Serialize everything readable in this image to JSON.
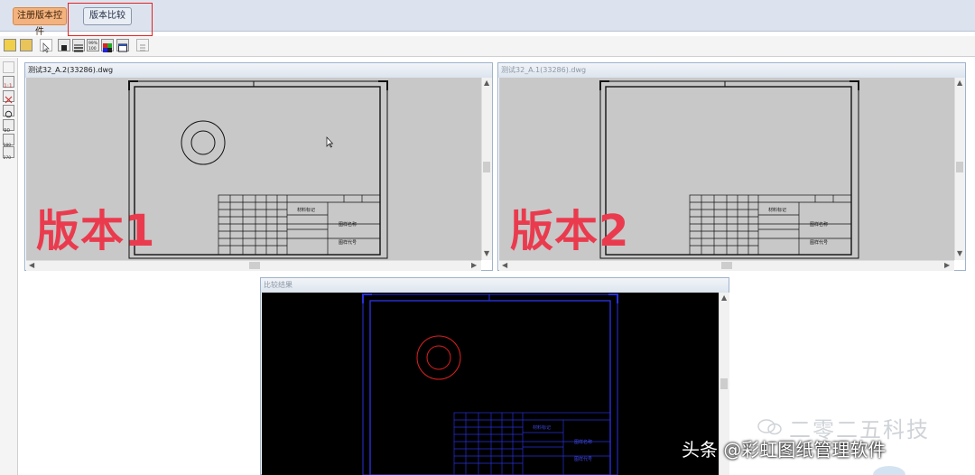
{
  "topbar": {
    "register_button": "注册版本控件",
    "compare_button": "版本比较"
  },
  "toolbar_icons": [
    "open-folder-icon",
    "open-file-icon",
    "pointer-icon",
    "layer-icon",
    "lineweight-icon",
    "zoom-percent-icon",
    "color-block-icon",
    "window-icon",
    "properties-icon"
  ],
  "side_icons": [
    "print-icon",
    "zoom-fit-icon",
    "zoom-extent-icon",
    "rotate-icon",
    "rotate-90-icon",
    "rotate-180-icon",
    "rotate-270-icon"
  ],
  "panels": {
    "version1": {
      "title": "测试32_A.2(33286).dwg"
    },
    "version2": {
      "title": "测试32_A.1(33286).dwg"
    },
    "result": {
      "title": "比较结果"
    }
  },
  "overlay_labels": {
    "v1": "版本1",
    "v2": "版本2"
  },
  "title_block": {
    "material_mark": "材料标记",
    "drawing_name": "图样名称",
    "drawing_code": "图样代号"
  },
  "watermark": "二零二五科技",
  "footer": "头条 @彩虹图纸管理软件",
  "colors": {
    "highlight": "#e02424",
    "label": "#ea3b4e",
    "result_frame": "#2a30d8",
    "result_diff": "#e02020",
    "cad_bg": "#c8c8c8"
  }
}
